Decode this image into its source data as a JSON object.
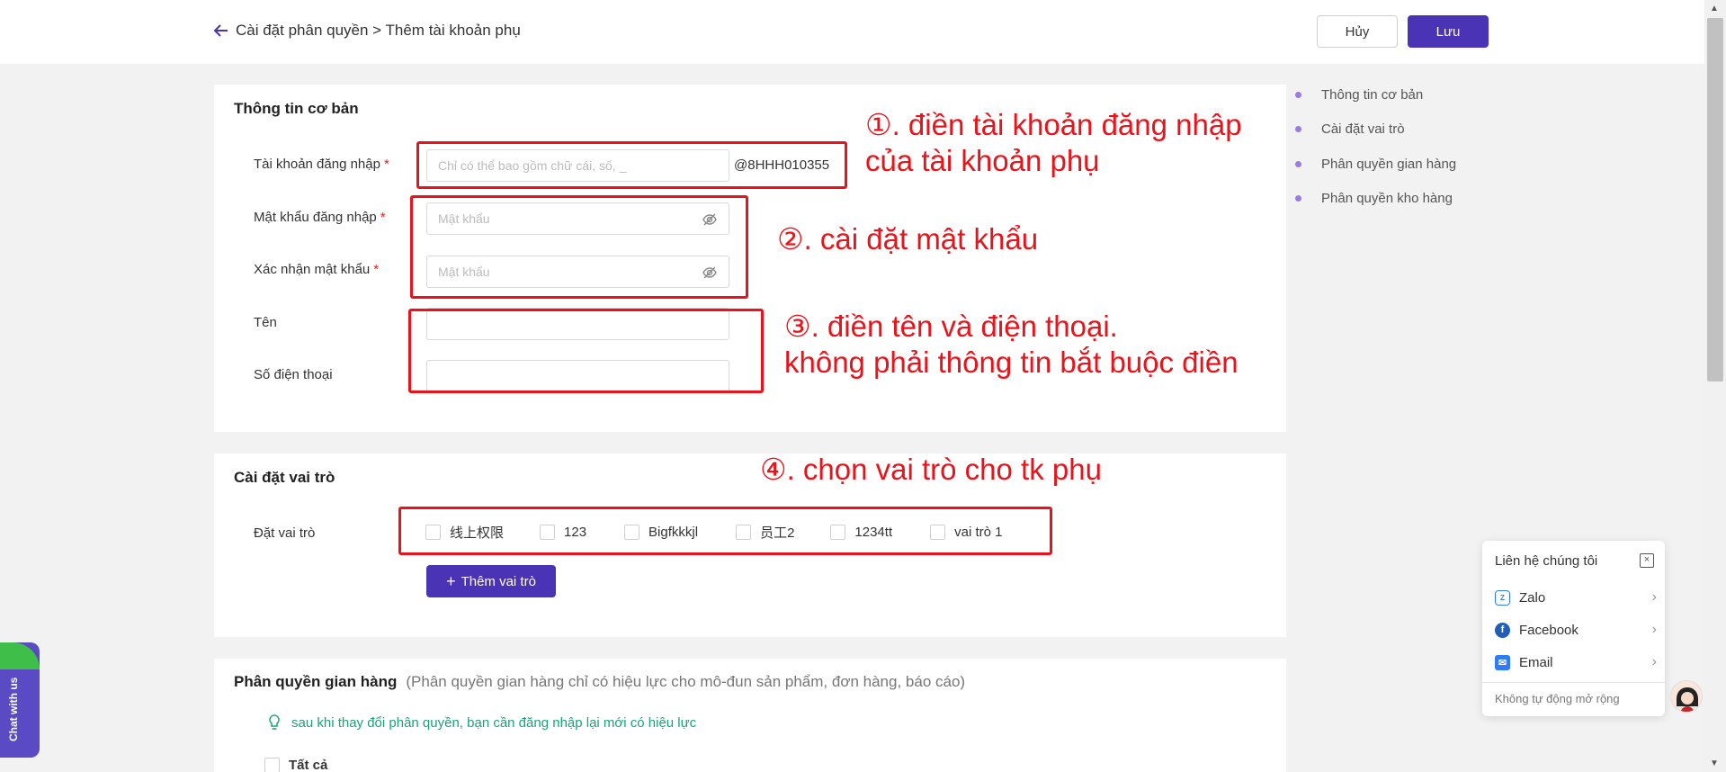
{
  "header": {
    "breadcrumb": "Cài đặt phân quyền > Thêm tài khoản phụ",
    "cancel_label": "Hủy",
    "save_label": "Lưu"
  },
  "basic_info": {
    "title": "Thông tin cơ bản",
    "login_account": {
      "label": "Tài khoản đăng nhập",
      "required": "*",
      "placeholder": "Chỉ có thể bao gồm chữ cái, số, _",
      "suffix": "@8HHH010355"
    },
    "password": {
      "label": "Mật khẩu đăng nhập",
      "required": "*",
      "placeholder": "Mật khẩu"
    },
    "confirm_password": {
      "label": "Xác nhận mật khẩu",
      "required": "*",
      "placeholder": "Mật khẩu"
    },
    "name": {
      "label": "Tên",
      "value": ""
    },
    "phone": {
      "label": "Số điện thoại",
      "value": ""
    }
  },
  "role_settings": {
    "title": "Cài đặt vai trò",
    "label": "Đặt vai trò",
    "roles": [
      "线上权限",
      "123",
      "Bigfkkkjl",
      "员工2",
      "1234tt",
      "vai trò 1"
    ],
    "add_role_label": "Thêm vai trò"
  },
  "store_permissions": {
    "title": "Phân quyền gian hàng",
    "hint": "(Phân quyền gian hàng chỉ có hiệu lực cho mô-đun sản phẩm, đơn hàng, báo cáo)",
    "note": "sau khi thay đổi phân quyền, bạn cần đăng nhập lại mới có hiệu lực",
    "all_label": "Tất cả"
  },
  "annotations": {
    "a1_line1": "①. điền tài khoản đăng nhập",
    "a1_line2": "của tài khoản phụ",
    "a2": "②. cài đặt mật khẩu",
    "a3_line1": "③. điền tên và điện thoại.",
    "a3_line2": "không phải thông tin bắt buộc điền",
    "a4": "④. chọn vai trò cho tk phụ",
    "color": "#e8141c"
  },
  "anchor_nav": [
    "Thông tin cơ bản",
    "Cài đặt vai trò",
    "Phân quyền gian hàng",
    "Phân quyền kho hàng"
  ],
  "contact_panel": {
    "title": "Liên hệ chúng tôi",
    "items": [
      {
        "label": "Zalo",
        "icon": "zalo-icon"
      },
      {
        "label": "Facebook",
        "icon": "facebook-icon"
      },
      {
        "label": "Email",
        "icon": "email-icon"
      }
    ],
    "footer": "Không tự động mở rộng"
  },
  "chat_tab": {
    "label": "Chat with us"
  },
  "colors": {
    "primary": "#4a33b5",
    "anchor_dot": "#9a7be0",
    "note_green": "#1aa37a"
  }
}
